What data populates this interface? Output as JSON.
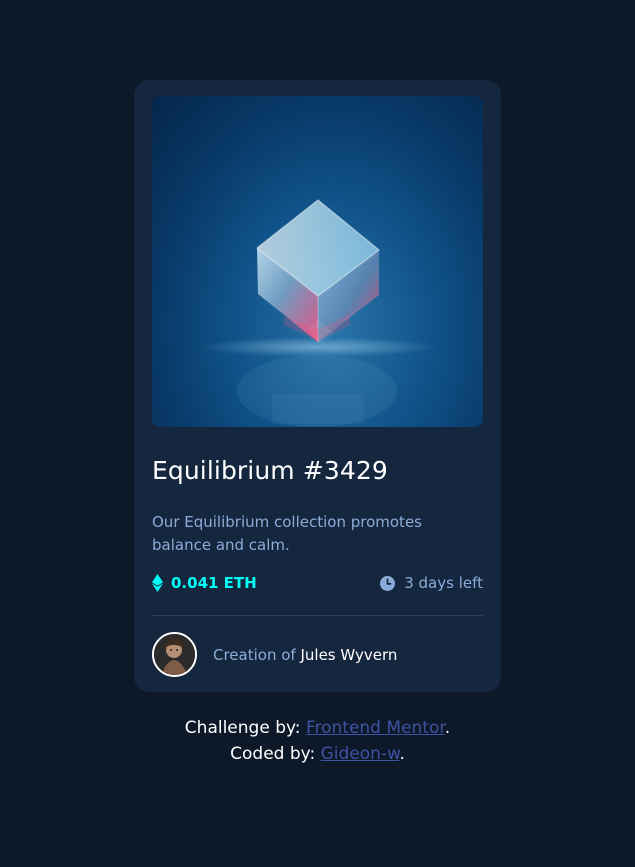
{
  "card": {
    "title": "Equilibrium #3429",
    "description": "Our Equilibrium collection promotes balance and calm.",
    "price": "0.041 ETH",
    "time_left": "3 days left",
    "creator_prefix": "Creation of",
    "creator_name": "Jules Wyvern",
    "icons": {
      "image": "crystal-cube-image",
      "price": "ethereum-icon",
      "time": "clock-icon",
      "avatar": "avatar"
    }
  },
  "attribution": {
    "line1_prefix": "Challenge by:",
    "line1_link": "Frontend Mentor",
    "line2_prefix": "Coded by:",
    "line2_link": "Gideon-w",
    "period": "."
  },
  "colors": {
    "page_bg": "#0d1829",
    "card_bg": "#15263f",
    "accent_cyan": "#00fff8",
    "soft_blue": "#8bacd9",
    "link_blue": "#3e52a3",
    "white": "#ffffff"
  }
}
